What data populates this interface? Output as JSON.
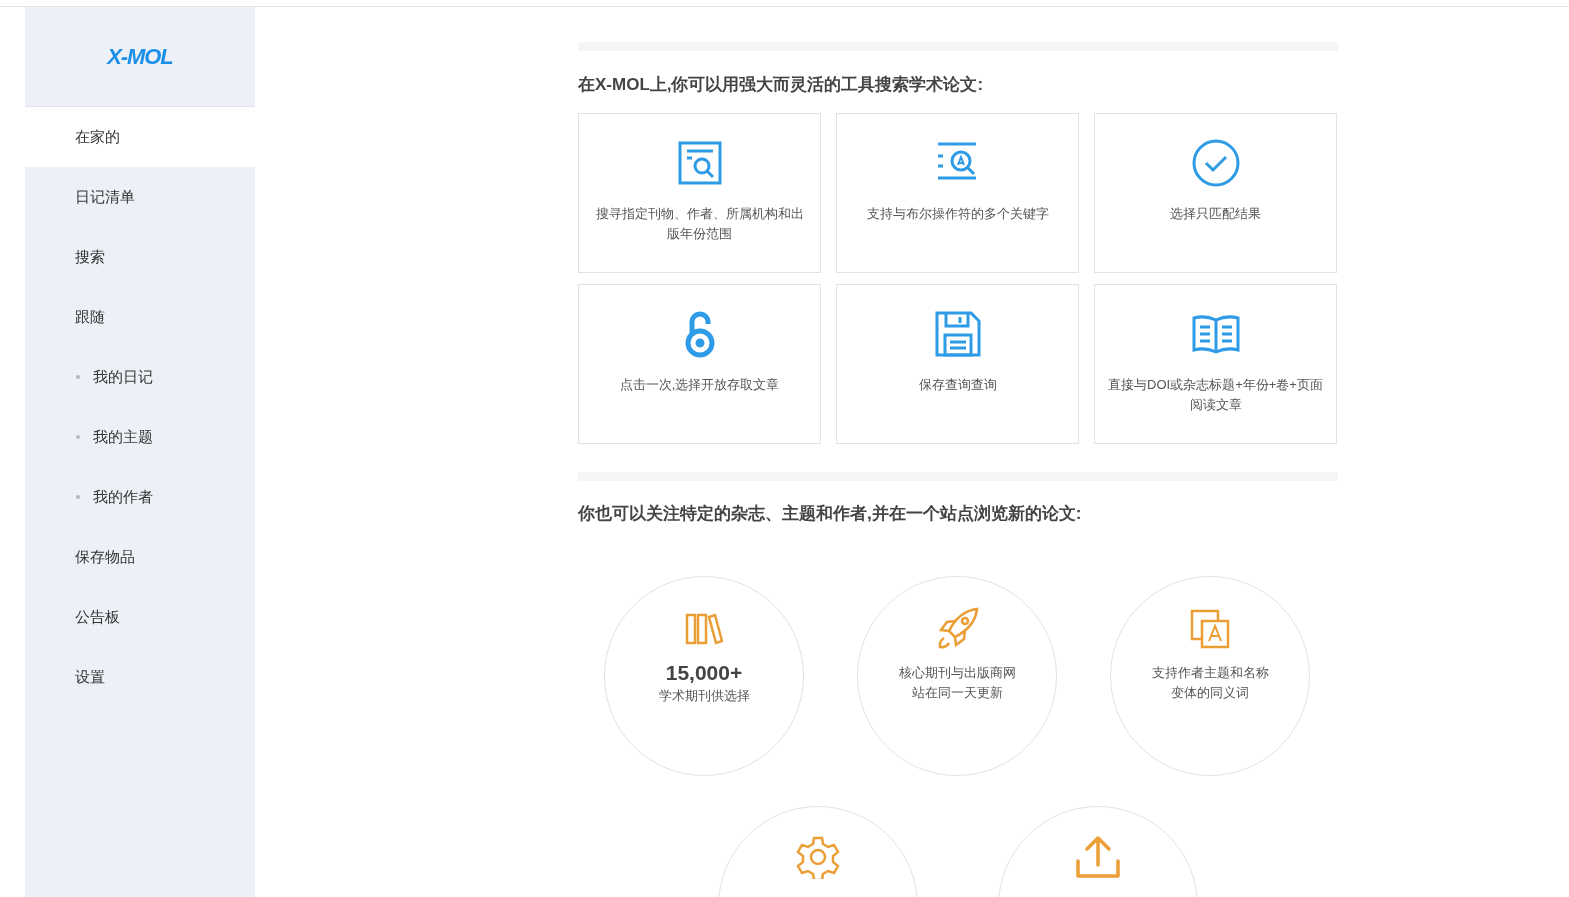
{
  "logo": "X-MOL",
  "sidebar": {
    "items": [
      {
        "label": "在家的",
        "kind": "main",
        "selected": true
      },
      {
        "label": "日记清单",
        "kind": "main",
        "selected": false
      },
      {
        "label": "搜索",
        "kind": "main",
        "selected": false
      },
      {
        "label": "跟随",
        "kind": "main",
        "selected": false
      },
      {
        "label": "我的日记",
        "kind": "sub",
        "selected": false
      },
      {
        "label": "我的主题",
        "kind": "sub",
        "selected": false
      },
      {
        "label": "我的作者",
        "kind": "sub",
        "selected": false
      },
      {
        "label": "保存物品",
        "kind": "main",
        "selected": false
      },
      {
        "label": "公告板",
        "kind": "main",
        "selected": false
      },
      {
        "label": "设置",
        "kind": "main",
        "selected": false
      }
    ]
  },
  "search_section": {
    "heading": "在X-MOL上,你可以用强大而灵活的工具搜索学术论文:",
    "features": [
      {
        "text": "搜寻指定刊物、作者、所属机构和出版年份范围"
      },
      {
        "text": "支持与布尔操作符的多个关键字"
      },
      {
        "text": "选择只匹配结果"
      },
      {
        "text": "点击一次,选择开放存取文章"
      },
      {
        "text": "保存查询查询"
      },
      {
        "text": "直接与DOI或杂志标题+年份+卷+页面阅读文章"
      }
    ]
  },
  "follow_section": {
    "heading": "你也可以关注特定的杂志、主题和作者,并在一个站点浏览新的论文:",
    "highlights": [
      {
        "kind": "stat",
        "number": "15,000+",
        "text": "学术期刊供选择"
      },
      {
        "kind": "text",
        "text": "核心期刊与出版商网站在同一天更新"
      },
      {
        "kind": "text",
        "text": "支持作者主题和名称变体的同义词"
      },
      {
        "kind": "icon"
      },
      {
        "kind": "icon"
      }
    ]
  }
}
